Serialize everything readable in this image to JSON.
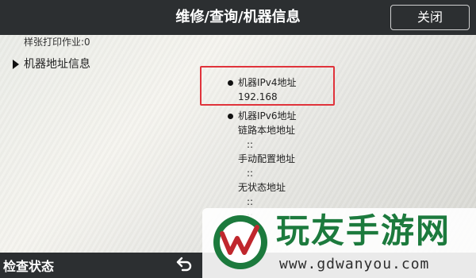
{
  "header": {
    "title": "维修/查询/机器信息",
    "close_label": "关闭"
  },
  "left": {
    "sample_print_job": "样张打印作业:0",
    "section_label": "机器地址信息"
  },
  "right": {
    "ipv4_label": "机器IPv4地址",
    "ipv4_value": "192.168",
    "ipv6_label": "机器IPv6地址",
    "link_local_label": "链路本地地址",
    "colon_1": "::",
    "manual_label": "手动配置地址",
    "colon_2": "::",
    "stateless_label": "无状态地址",
    "colon_3": "::",
    "colon_4": "::",
    "colon_5": "::"
  },
  "footer": {
    "status_label": "检查状态",
    "back_icon": "back-arrow-icon"
  },
  "watermark": {
    "title": "玩友手游网",
    "url": "www.gdwanyou.com"
  },
  "colors": {
    "header_bg": "#2c2f31",
    "highlight": "#e0333b",
    "brand_green": "#1c7a3d"
  }
}
